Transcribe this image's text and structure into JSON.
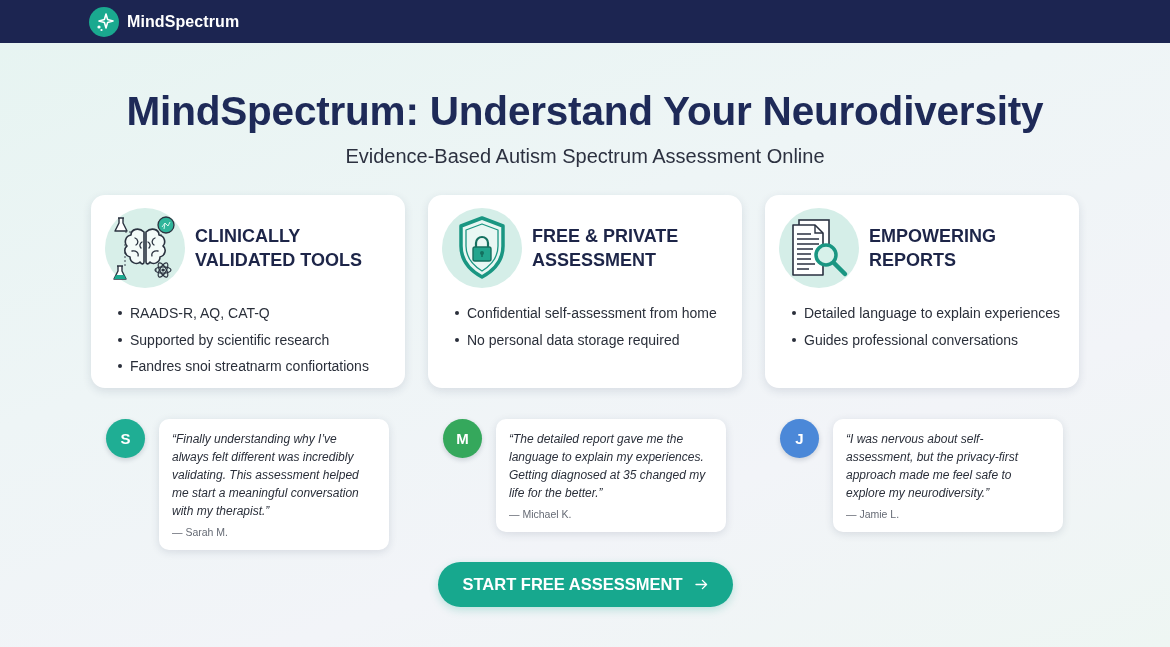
{
  "header": {
    "brand": "MindSpectrum"
  },
  "hero": {
    "title": "MindSpectrum: Understand Your Neurodiversity",
    "subtitle": "Evidence-Based Autism Spectrum Assessment Online"
  },
  "features": [
    {
      "kind": "brain",
      "title": "CLINICALLY VALIDATED TOOLS",
      "bullets": [
        "RAADS-R, AQ, CAT-Q",
        "Supported by scientific research",
        "Fandres snoi streatnarm confiortations"
      ]
    },
    {
      "kind": "shield",
      "title": "FREE & PRIVATE ASSESSMENT",
      "bullets": [
        "Confidential self-assessment from home",
        "No personal data storage required"
      ]
    },
    {
      "kind": "document",
      "title": "EMPOWERING REPORTS",
      "bullets": [
        "Detailed language to explain experiences",
        "Guides professional conversations"
      ]
    }
  ],
  "testimonials": [
    {
      "initial": "S",
      "color": "#1fae94",
      "quote": "“Finally understanding why I’ve always felt different was incredibly validating. This assessment helped me start a meaningful conversation with my therapist.”",
      "author": "— Sarah M."
    },
    {
      "initial": "M",
      "color": "#35a85c",
      "quote": "“The detailed report gave me the language to explain my experiences. Getting diagnosed at 35 changed my life for the better.”",
      "author": "— Michael K."
    },
    {
      "initial": "J",
      "color": "#4b88d8",
      "quote": "“I was nervous about self-assessment, but the privacy-first approach made me feel safe to explore my neurodiversity.”",
      "author": "— Jamie L."
    }
  ],
  "cta": {
    "label": "START FREE ASSESSMENT"
  }
}
